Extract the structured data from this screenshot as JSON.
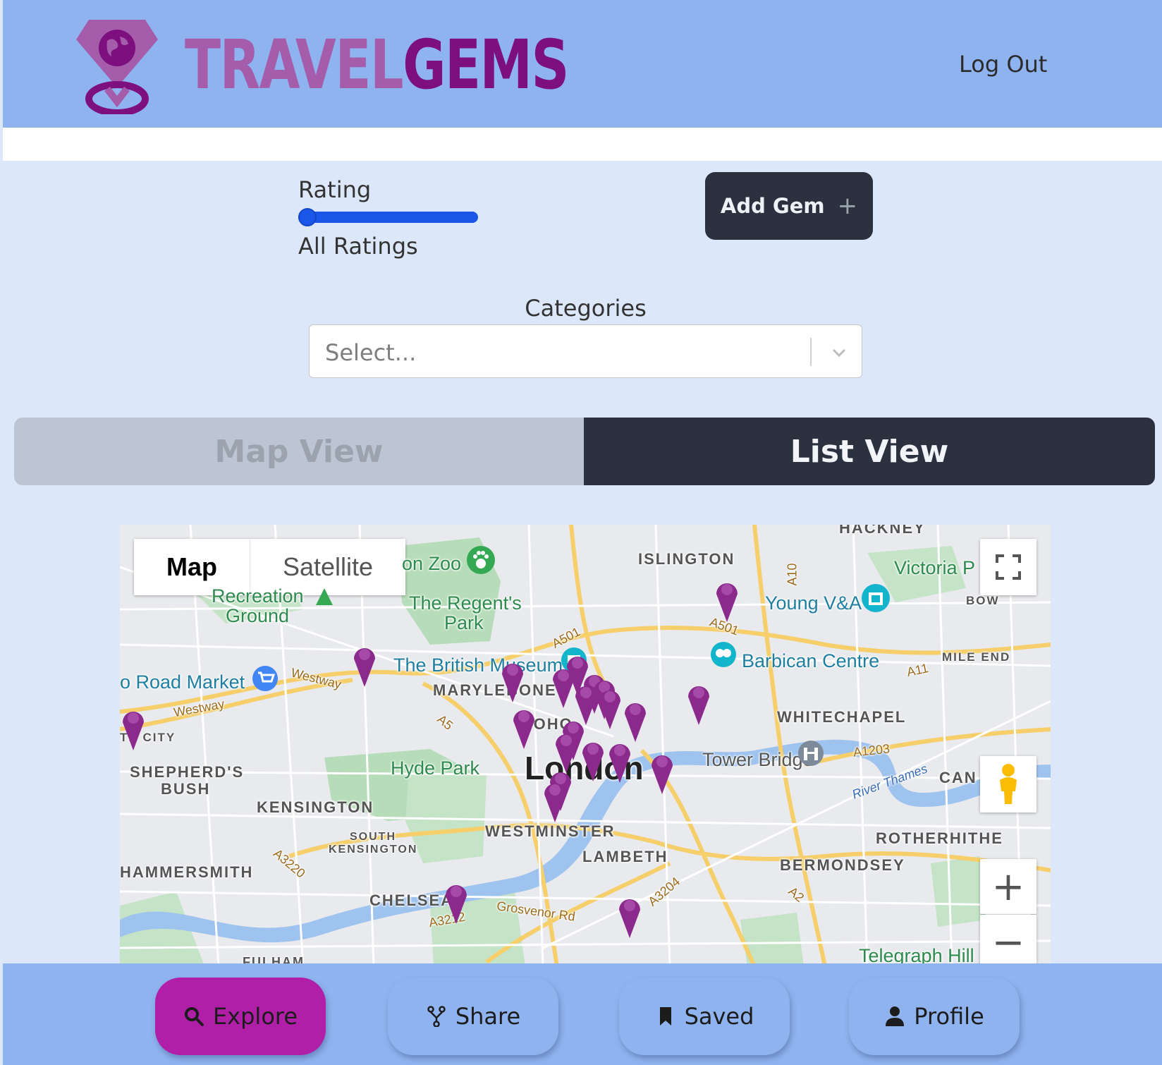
{
  "header": {
    "brand_part1": "TRAVEL",
    "brand_part2": "GEMS",
    "logout_label": "Log Out"
  },
  "filters": {
    "rating_label": "Rating",
    "rating_value_text": "All Ratings",
    "rating_slider_position": 0,
    "add_gem_label": "Add Gem",
    "categories_label": "Categories",
    "categories_placeholder": "Select..."
  },
  "view_toggle": {
    "map_label": "Map View",
    "list_label": "List View",
    "selected": "List View"
  },
  "map": {
    "type_options": [
      "Map",
      "Satellite"
    ],
    "selected_type": "Map",
    "zoom_in": "+",
    "zoom_out": "−",
    "labels": {
      "hackney": "HACKNEY",
      "islington": "ISLINGTON",
      "zoo": "on Zoo",
      "regents_park_1": "The Regent's",
      "regents_park_2": "Park",
      "victoria_park": "Victoria P",
      "young_va": "Young V&A",
      "bow": "BOW",
      "recreation_1": "Recreation",
      "recreation_2": "Ground",
      "british_museum": "The British Museum",
      "barbican": "Barbican Centre",
      "mile_end": "MILE END",
      "road_market": "o Road Market",
      "marylebone": "MARYLEBONE",
      "whitechapel": "WHITECHAPEL",
      "soho": "SOHO",
      "white_city": "TE CITY",
      "shepherds_bush_1": "SHEPHERD'S",
      "shepherds_bush_2": "BUSH",
      "hyde_park": "Hyde Park",
      "london": "London",
      "tower_bridge": "Tower Bridge",
      "canary": "CAN",
      "kensington": "KENSINGTON",
      "river_thames": "River Thames",
      "south_kensington_1": "SOUTH",
      "south_kensington_2": "KENSINGTON",
      "westminster": "WESTMINSTER",
      "rotherhithe": "ROTHERHITHE",
      "lambeth": "LAMBETH",
      "bermondsey": "BERMONDSEY",
      "hammersmith": "HAMMERSMITH",
      "chelsea": "CHELSEA",
      "grosvenor_rd": "Grosvenor Rd",
      "fulham": "FULHAM",
      "telegraph_hill": "Telegraph Hill",
      "westway": "Westway",
      "westway_2": "Westway",
      "a501": "A501",
      "a501_b": "A501",
      "a10": "A10",
      "a11": "A11",
      "a1203": "A1203",
      "a5": "A5",
      "a3220": "A3220",
      "a3204": "A3204",
      "a2": "A2",
      "a3212": "A3212"
    },
    "gem_pin_count": 26
  },
  "bottom_nav": {
    "explore": "Explore",
    "share": "Share",
    "saved": "Saved",
    "profile": "Profile",
    "active": "Explore"
  },
  "colors": {
    "header_bg": "#8fb3ef",
    "page_bg": "#dce7f9",
    "brand_light": "#a45cab",
    "brand_dark": "#7d0f7f",
    "dark_button": "#2b313e",
    "active_nav": "#b11fa8",
    "slider": "#1a56e8",
    "pin": "#8b2a8c"
  }
}
